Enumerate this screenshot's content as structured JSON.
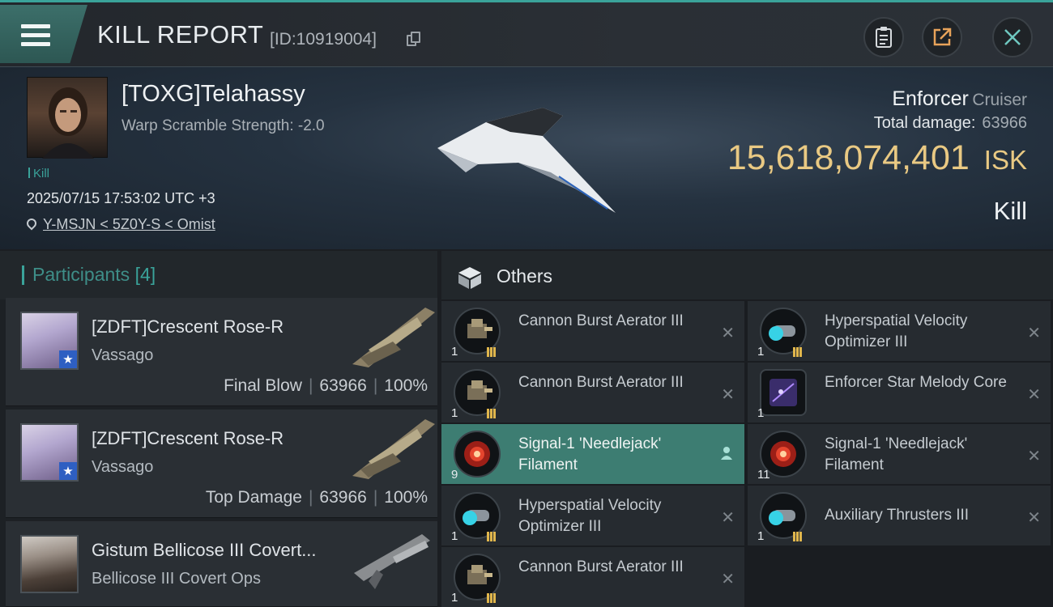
{
  "header": {
    "title": "KILL REPORT",
    "report_id": "[ID:10919004]"
  },
  "victim": {
    "name": "[TOXG]Telahassy",
    "warp_scramble": "Warp Scramble Strength: -2.0",
    "tag": "Kill",
    "datetime": "2025/07/15 17:53:02 UTC +3",
    "location": "Y-MSJN < 5Z0Y-S < Omist",
    "ship_name": "Enforcer",
    "ship_class": "Cruiser",
    "total_damage_label": "Total damage:",
    "total_damage": "63966",
    "isk_value": "15,618,074,401",
    "isk_unit": "ISK",
    "result": "Kill"
  },
  "participants": {
    "label": "Participants",
    "count": "[4]",
    "items": [
      {
        "name": "[ZDFT]Crescent Rose-R",
        "ship": "Vassago",
        "role": "Final Blow",
        "damage": "63966",
        "percent": "100%"
      },
      {
        "name": "[ZDFT]Crescent Rose-R",
        "ship": "Vassago",
        "role": "Top Damage",
        "damage": "63966",
        "percent": "100%"
      },
      {
        "name": "Gistum Bellicose III Covert...",
        "ship": "Bellicose III Covert Ops"
      }
    ]
  },
  "others": {
    "title": "Others",
    "left": [
      {
        "name": "Cannon Burst Aerator III",
        "qty": "1",
        "icon": "weapon-module-icon"
      },
      {
        "name": "Cannon Burst Aerator III",
        "qty": "1",
        "icon": "weapon-module-icon"
      },
      {
        "name": "Signal-1 'Needlejack' Filament",
        "qty": "9",
        "icon": "filament-icon"
      },
      {
        "name": "Hyperspatial Velocity Optimizer III",
        "qty": "1",
        "icon": "thruster-module-icon"
      },
      {
        "name": "Cannon Burst Aerator III",
        "qty": "1",
        "icon": "weapon-module-icon"
      }
    ],
    "right": [
      {
        "name": "Hyperspatial Velocity Optimizer III",
        "qty": "1",
        "icon": "thruster-module-icon"
      },
      {
        "name": "Enforcer Star Melody Core",
        "qty": "1",
        "icon": "core-icon"
      },
      {
        "name": "Signal-1 'Needlejack' Filament",
        "qty": "11",
        "icon": "filament-icon"
      },
      {
        "name": "Auxiliary Thrusters III",
        "qty": "1",
        "icon": "thruster-module-icon"
      }
    ]
  },
  "colors": {
    "accent": "#3aa39a",
    "isk_gold": "#e9c983",
    "highlight_row": "#3d7d72"
  }
}
